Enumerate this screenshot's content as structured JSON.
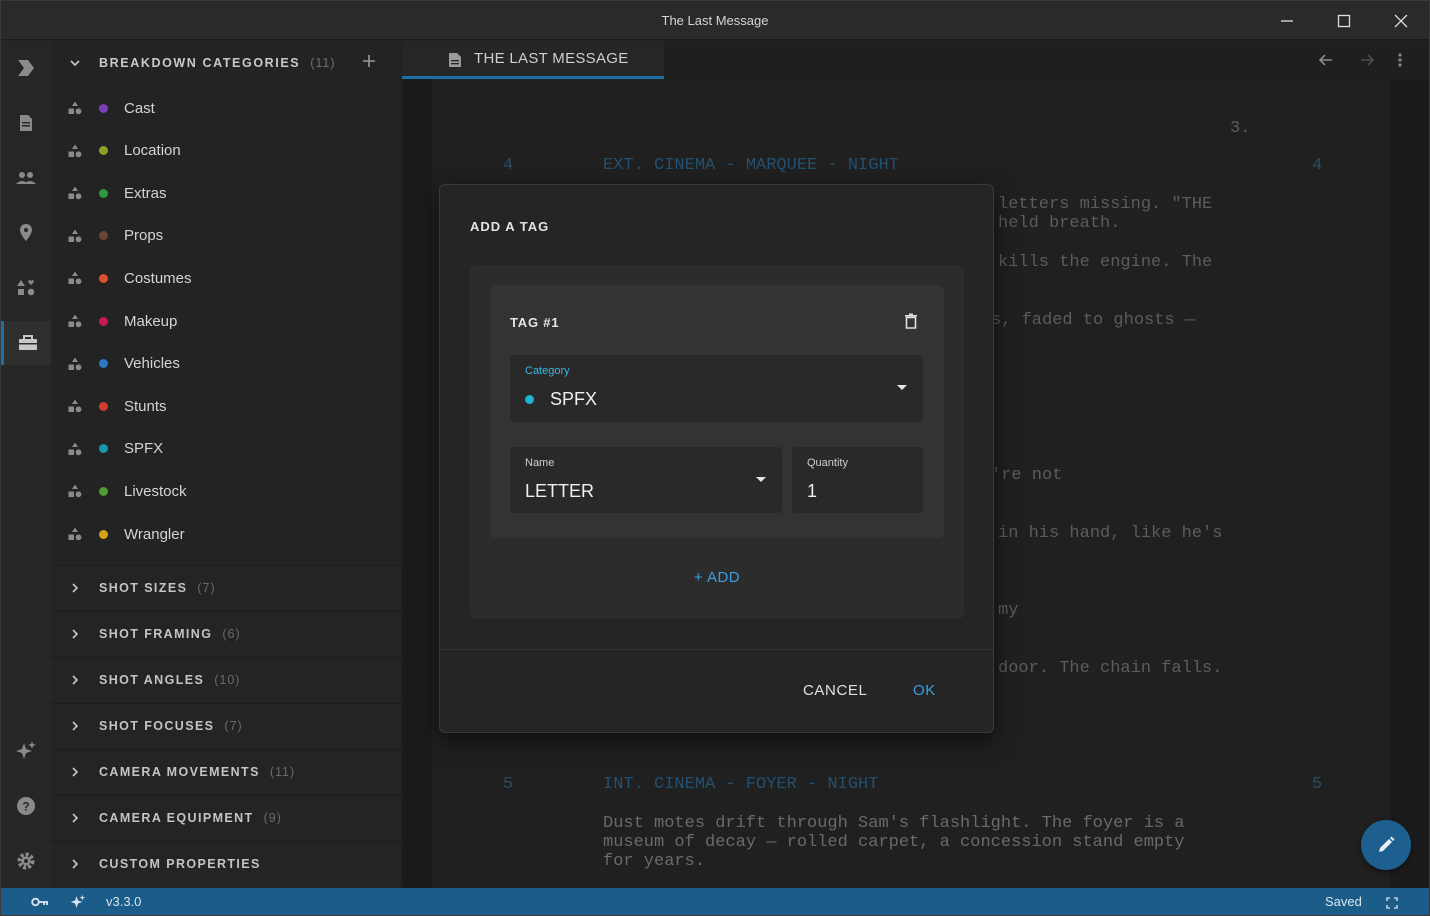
{
  "window": {
    "title": "The Last Message"
  },
  "categories_section": {
    "label": "BREAKDOWN CATEGORIES",
    "count": "(11)"
  },
  "categories": [
    {
      "name": "Cast",
      "color": "#7b3fb5"
    },
    {
      "name": "Location",
      "color": "#8aa22a"
    },
    {
      "name": "Extras",
      "color": "#2f9a3a"
    },
    {
      "name": "Props",
      "color": "#6a4636"
    },
    {
      "name": "Costumes",
      "color": "#d9502a"
    },
    {
      "name": "Makeup",
      "color": "#c81a55"
    },
    {
      "name": "Vehicles",
      "color": "#2a79c6"
    },
    {
      "name": "Stunts",
      "color": "#d13a2f"
    },
    {
      "name": "SPFX",
      "color": "#1996a8"
    },
    {
      "name": "Livestock",
      "color": "#4f9a34"
    },
    {
      "name": "Wrangler",
      "color": "#d4a017"
    }
  ],
  "sections": [
    {
      "label": "SHOT SIZES",
      "count": "(7)"
    },
    {
      "label": "SHOT FRAMING",
      "count": "(6)"
    },
    {
      "label": "SHOT ANGLES",
      "count": "(10)"
    },
    {
      "label": "SHOT FOCUSES",
      "count": "(7)"
    },
    {
      "label": "CAMERA MOVEMENTS",
      "count": "(11)"
    },
    {
      "label": "CAMERA EQUIPMENT",
      "count": "(9)"
    },
    {
      "label": "CUSTOM PROPERTIES",
      "count": ""
    }
  ],
  "tab": {
    "label": "THE LAST MESSAGE"
  },
  "script": {
    "page_number": "3.",
    "scene4_num": "4",
    "scene4_heading": "EXT. CINEMA - MARQUEE - NIGHT",
    "lines": [
      "letters missing. \"THE",
      "held breath.",
      "kills the engine. The",
      "s, faded to ghosts —",
      "'re not",
      "in his hand, like he's",
      "my",
      "door. The chain falls."
    ],
    "scene5_num": "5",
    "scene5_heading": "INT. CINEMA - FOYER - NIGHT",
    "scene5_action": "Dust motes drift through Sam's flashlight. The foyer is a\nmuseum of decay — rolled carpet, a concession stand empty\nfor years."
  },
  "dialog": {
    "title": "ADD A TAG",
    "tag_title": "TAG #1",
    "category_label": "Category",
    "category_value": "SPFX",
    "category_color": "#1fb2d8",
    "name_label": "Name",
    "name_value": "LETTER",
    "quantity_label": "Quantity",
    "quantity_value": "1",
    "add_label": "+ ADD",
    "cancel_label": "CANCEL",
    "ok_label": "OK"
  },
  "status": {
    "version": "v3.3.0",
    "saved": "Saved"
  }
}
